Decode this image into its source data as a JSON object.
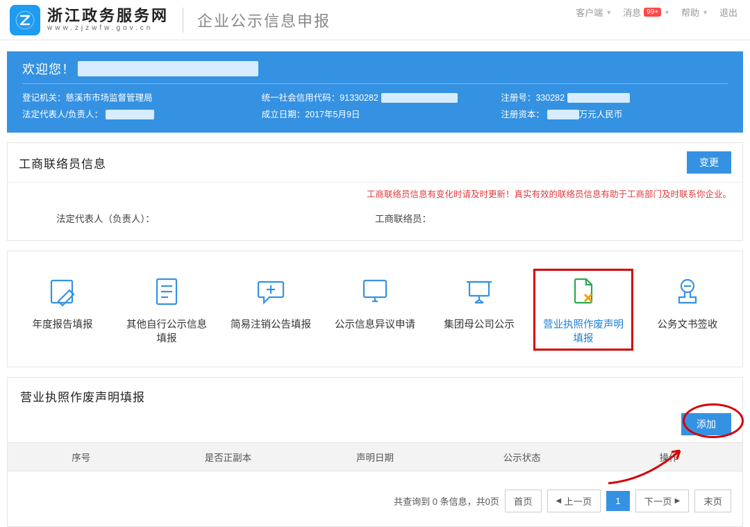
{
  "header": {
    "site_cn": "浙江政务服务网",
    "site_en": "www.zjzwfw.gov.cn",
    "page_title": "企业公示信息申报",
    "links": {
      "client": "客户端",
      "msg": "消息",
      "msg_badge": "99+",
      "help": "帮助",
      "logout": "退出"
    }
  },
  "banner": {
    "welcome_prefix": "欢迎您！",
    "reg_org_label": "登记机关：",
    "reg_org_value": "慈溪市市场监督管理局",
    "legal_rep_label": "法定代表人/负责人：",
    "usci_label": "统一社会信用代码：",
    "usci_value_prefix": "91330282",
    "found_date_label": "成立日期：",
    "found_date_value": "2017年5月9日",
    "reg_no_label": "注册号：",
    "reg_no_value_prefix": "330282",
    "reg_cap_label": "注册资本：",
    "reg_cap_suffix": "万元人民币"
  },
  "contact_card": {
    "title": "工商联络员信息",
    "change_btn": "变更",
    "warn": "工商联络员信息有变化时请及时更新！真实有效的联络员信息有助于工商部门及时联系你企业。",
    "legal_rep_label": "法定代表人（负责人）：",
    "liaison_label": "工商联络员："
  },
  "functions": [
    {
      "id": "annual-report",
      "label": "年度报告填报"
    },
    {
      "id": "self-publicity",
      "label": "其他自行公示信息填报"
    },
    {
      "id": "simple-cancel",
      "label": "简易注销公告填报"
    },
    {
      "id": "objection",
      "label": "公示信息异议申请"
    },
    {
      "id": "group-parent",
      "label": "集团母公司公示"
    },
    {
      "id": "license-void",
      "label": "营业执照作废声明填报",
      "active": true
    },
    {
      "id": "doc-receipt",
      "label": "公务文书签收"
    }
  ],
  "decl": {
    "title": "营业执照作废声明填报",
    "add_btn": "添加",
    "columns": [
      "序号",
      "是否正副本",
      "声明日期",
      "公示状态",
      "操作"
    ],
    "summary_prefix": "共查询到 ",
    "summary_count": "0",
    "summary_mid": " 条信息，共",
    "summary_pages": "0",
    "summary_suffix": "页",
    "first": "首页",
    "prev": "上一页",
    "cur": "1",
    "next": "下一页",
    "last": "末页"
  }
}
